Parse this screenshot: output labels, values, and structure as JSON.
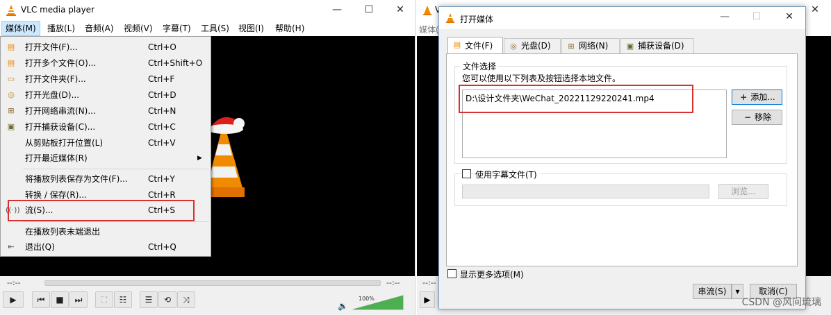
{
  "colors": {
    "accent": "#0078d7",
    "highlight": "#d9302f",
    "menu_active": "#cce8ff",
    "volume_green": "#4caf50"
  },
  "left_window": {
    "title": "VLC media player",
    "menu": [
      "媒体(M)",
      "播放(L)",
      "音频(A)",
      "视频(V)",
      "字幕(T)",
      "工具(S)",
      "视图(I)",
      "帮助(H)"
    ],
    "media_menu": [
      {
        "icon": "file-icon",
        "label": "打开文件(F)...",
        "shortcut": "Ctrl+O"
      },
      {
        "icon": "files-icon",
        "label": "打开多个文件(O)...",
        "shortcut": "Ctrl+Shift+O"
      },
      {
        "icon": "folder-icon",
        "label": "打开文件夹(F)...",
        "shortcut": "Ctrl+F"
      },
      {
        "icon": "disc-icon",
        "label": "打开光盘(D)...",
        "shortcut": "Ctrl+D"
      },
      {
        "icon": "network-icon",
        "label": "打开网络串流(N)...",
        "shortcut": "Ctrl+N"
      },
      {
        "icon": "capture-icon",
        "label": "打开捕获设备(C)...",
        "shortcut": "Ctrl+C"
      },
      {
        "icon": "",
        "label": "从剪贴板打开位置(L)",
        "shortcut": "Ctrl+V"
      },
      {
        "icon": "",
        "label": "打开最近媒体(R)",
        "shortcut": "",
        "submenu": true
      },
      {
        "icon": "",
        "label": "将播放列表保存为文件(F)...",
        "shortcut": "Ctrl+Y"
      },
      {
        "icon": "",
        "label": "转换 / 保存(R)...",
        "shortcut": "Ctrl+R"
      },
      {
        "icon": "stream-icon",
        "label": "流(S)...",
        "shortcut": "Ctrl+S"
      },
      {
        "icon": "",
        "label": "在播放列表末端退出",
        "shortcut": ""
      },
      {
        "icon": "quit-icon",
        "label": "退出(Q)",
        "shortcut": "Ctrl+Q"
      }
    ],
    "time_left": "--:--",
    "time_right": "--:--",
    "volume_percent": "100%",
    "volume_level": 1.0
  },
  "right_window": {
    "title": "VLC",
    "menu_first": "媒体(M)",
    "time_left": "--:--"
  },
  "dialog": {
    "title": "打开媒体",
    "tabs": [
      {
        "icon": "file-icon",
        "label": "文件(F)"
      },
      {
        "icon": "disc-icon",
        "label": "光盘(D)"
      },
      {
        "icon": "network-icon",
        "label": "网络(N)"
      },
      {
        "icon": "capture-icon",
        "label": "捕获设备(D)"
      }
    ],
    "file_group_title": "文件选择",
    "file_group_hint": "您可以使用以下列表及按钮选择本地文件。",
    "file_entries": [
      "D:\\设计文件夹\\WeChat_20221129220241.mp4"
    ],
    "add_button": "添加...",
    "remove_button": "移除",
    "subtitle_checkbox": "使用字幕文件(T)",
    "browse_button": "浏览...",
    "more_options": "显示更多选项(M)",
    "stream_button": "串流(S)",
    "cancel_button": "取消(C)"
  },
  "watermark": "CSDN @风间琉璃"
}
